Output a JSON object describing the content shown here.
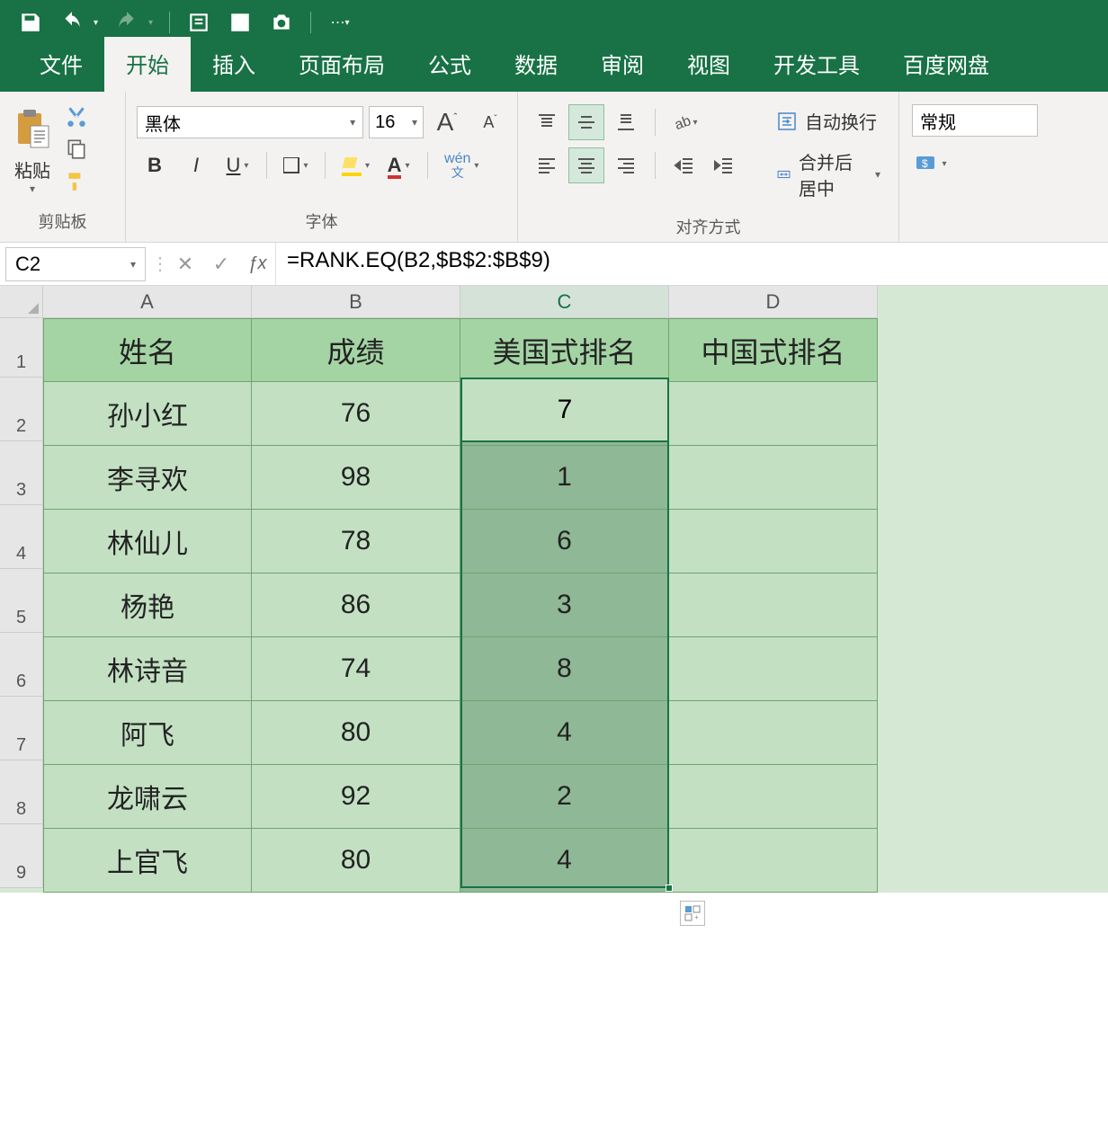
{
  "qat": {
    "icons": [
      "save",
      "undo",
      "redo",
      "touch",
      "star",
      "camera",
      "more"
    ]
  },
  "tabs": [
    "文件",
    "开始",
    "插入",
    "页面布局",
    "公式",
    "数据",
    "审阅",
    "视图",
    "开发工具",
    "百度网盘"
  ],
  "activeTab": "开始",
  "ribbon": {
    "clipboard": {
      "paste": "粘贴",
      "label": "剪贴板"
    },
    "font": {
      "name": "黑体",
      "size": "16",
      "label": "字体"
    },
    "align": {
      "wrap": "自动换行",
      "merge": "合并后居中",
      "label": "对齐方式"
    },
    "number": {
      "format": "常规"
    }
  },
  "nameBox": "C2",
  "formula": "=RANK.EQ(B2,$B$2:$B$9)",
  "cols": [
    "A",
    "B",
    "C",
    "D"
  ],
  "headers": [
    "姓名",
    "成绩",
    "美国式排名",
    "中国式排名"
  ],
  "rows": [
    {
      "a": "孙小红",
      "b": "76",
      "c": "7",
      "d": ""
    },
    {
      "a": "李寻欢",
      "b": "98",
      "c": "1",
      "d": ""
    },
    {
      "a": "林仙儿",
      "b": "78",
      "c": "6",
      "d": ""
    },
    {
      "a": "杨艳",
      "b": "86",
      "c": "3",
      "d": ""
    },
    {
      "a": "林诗音",
      "b": "74",
      "c": "8",
      "d": ""
    },
    {
      "a": "阿飞",
      "b": "80",
      "c": "4",
      "d": ""
    },
    {
      "a": "龙啸云",
      "b": "92",
      "c": "2",
      "d": ""
    },
    {
      "a": "上官飞",
      "b": "80",
      "c": "4",
      "d": ""
    }
  ]
}
